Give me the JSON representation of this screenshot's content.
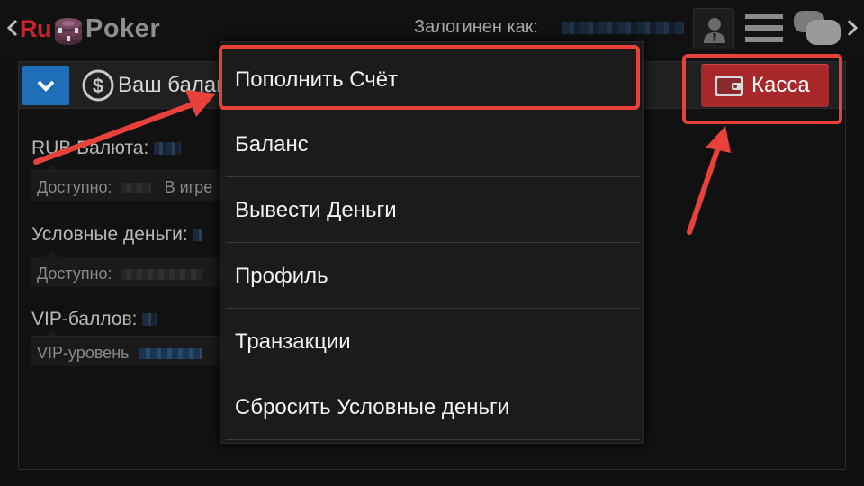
{
  "header": {
    "logo_ru": "Ru",
    "logo_poker": "Poker",
    "login_label": "Залогинен как:"
  },
  "balance": {
    "title": "Ваш баланс",
    "cashier_label": "Касса",
    "rub_label": "RUB Валюта:",
    "rub_available_label": "Доступно:",
    "rub_ingame_label": "В игре",
    "play_money_label": "Условные деньги:",
    "play_money_available_label": "Доступно:",
    "vip_label": "VIP-баллов:",
    "vip_level_label": "VIP-уровень"
  },
  "dropdown": {
    "items": [
      "Пополнить Счёт",
      "Баланс",
      "Вывести Деньги",
      "Профиль",
      "Транзакции",
      "Сбросить Условные деньги"
    ]
  },
  "colors": {
    "accent_blue": "#1f6fb8",
    "cashier_red": "#a8272a",
    "annotation_red": "#e8413a",
    "background": "#101010"
  },
  "icons": [
    "back-arrow-icon",
    "poker-chip-icon",
    "avatar-icon",
    "menu-icon",
    "chat-icon",
    "forward-arrow-icon",
    "chevron-down-icon",
    "dollar-coin-icon",
    "wallet-icon"
  ]
}
